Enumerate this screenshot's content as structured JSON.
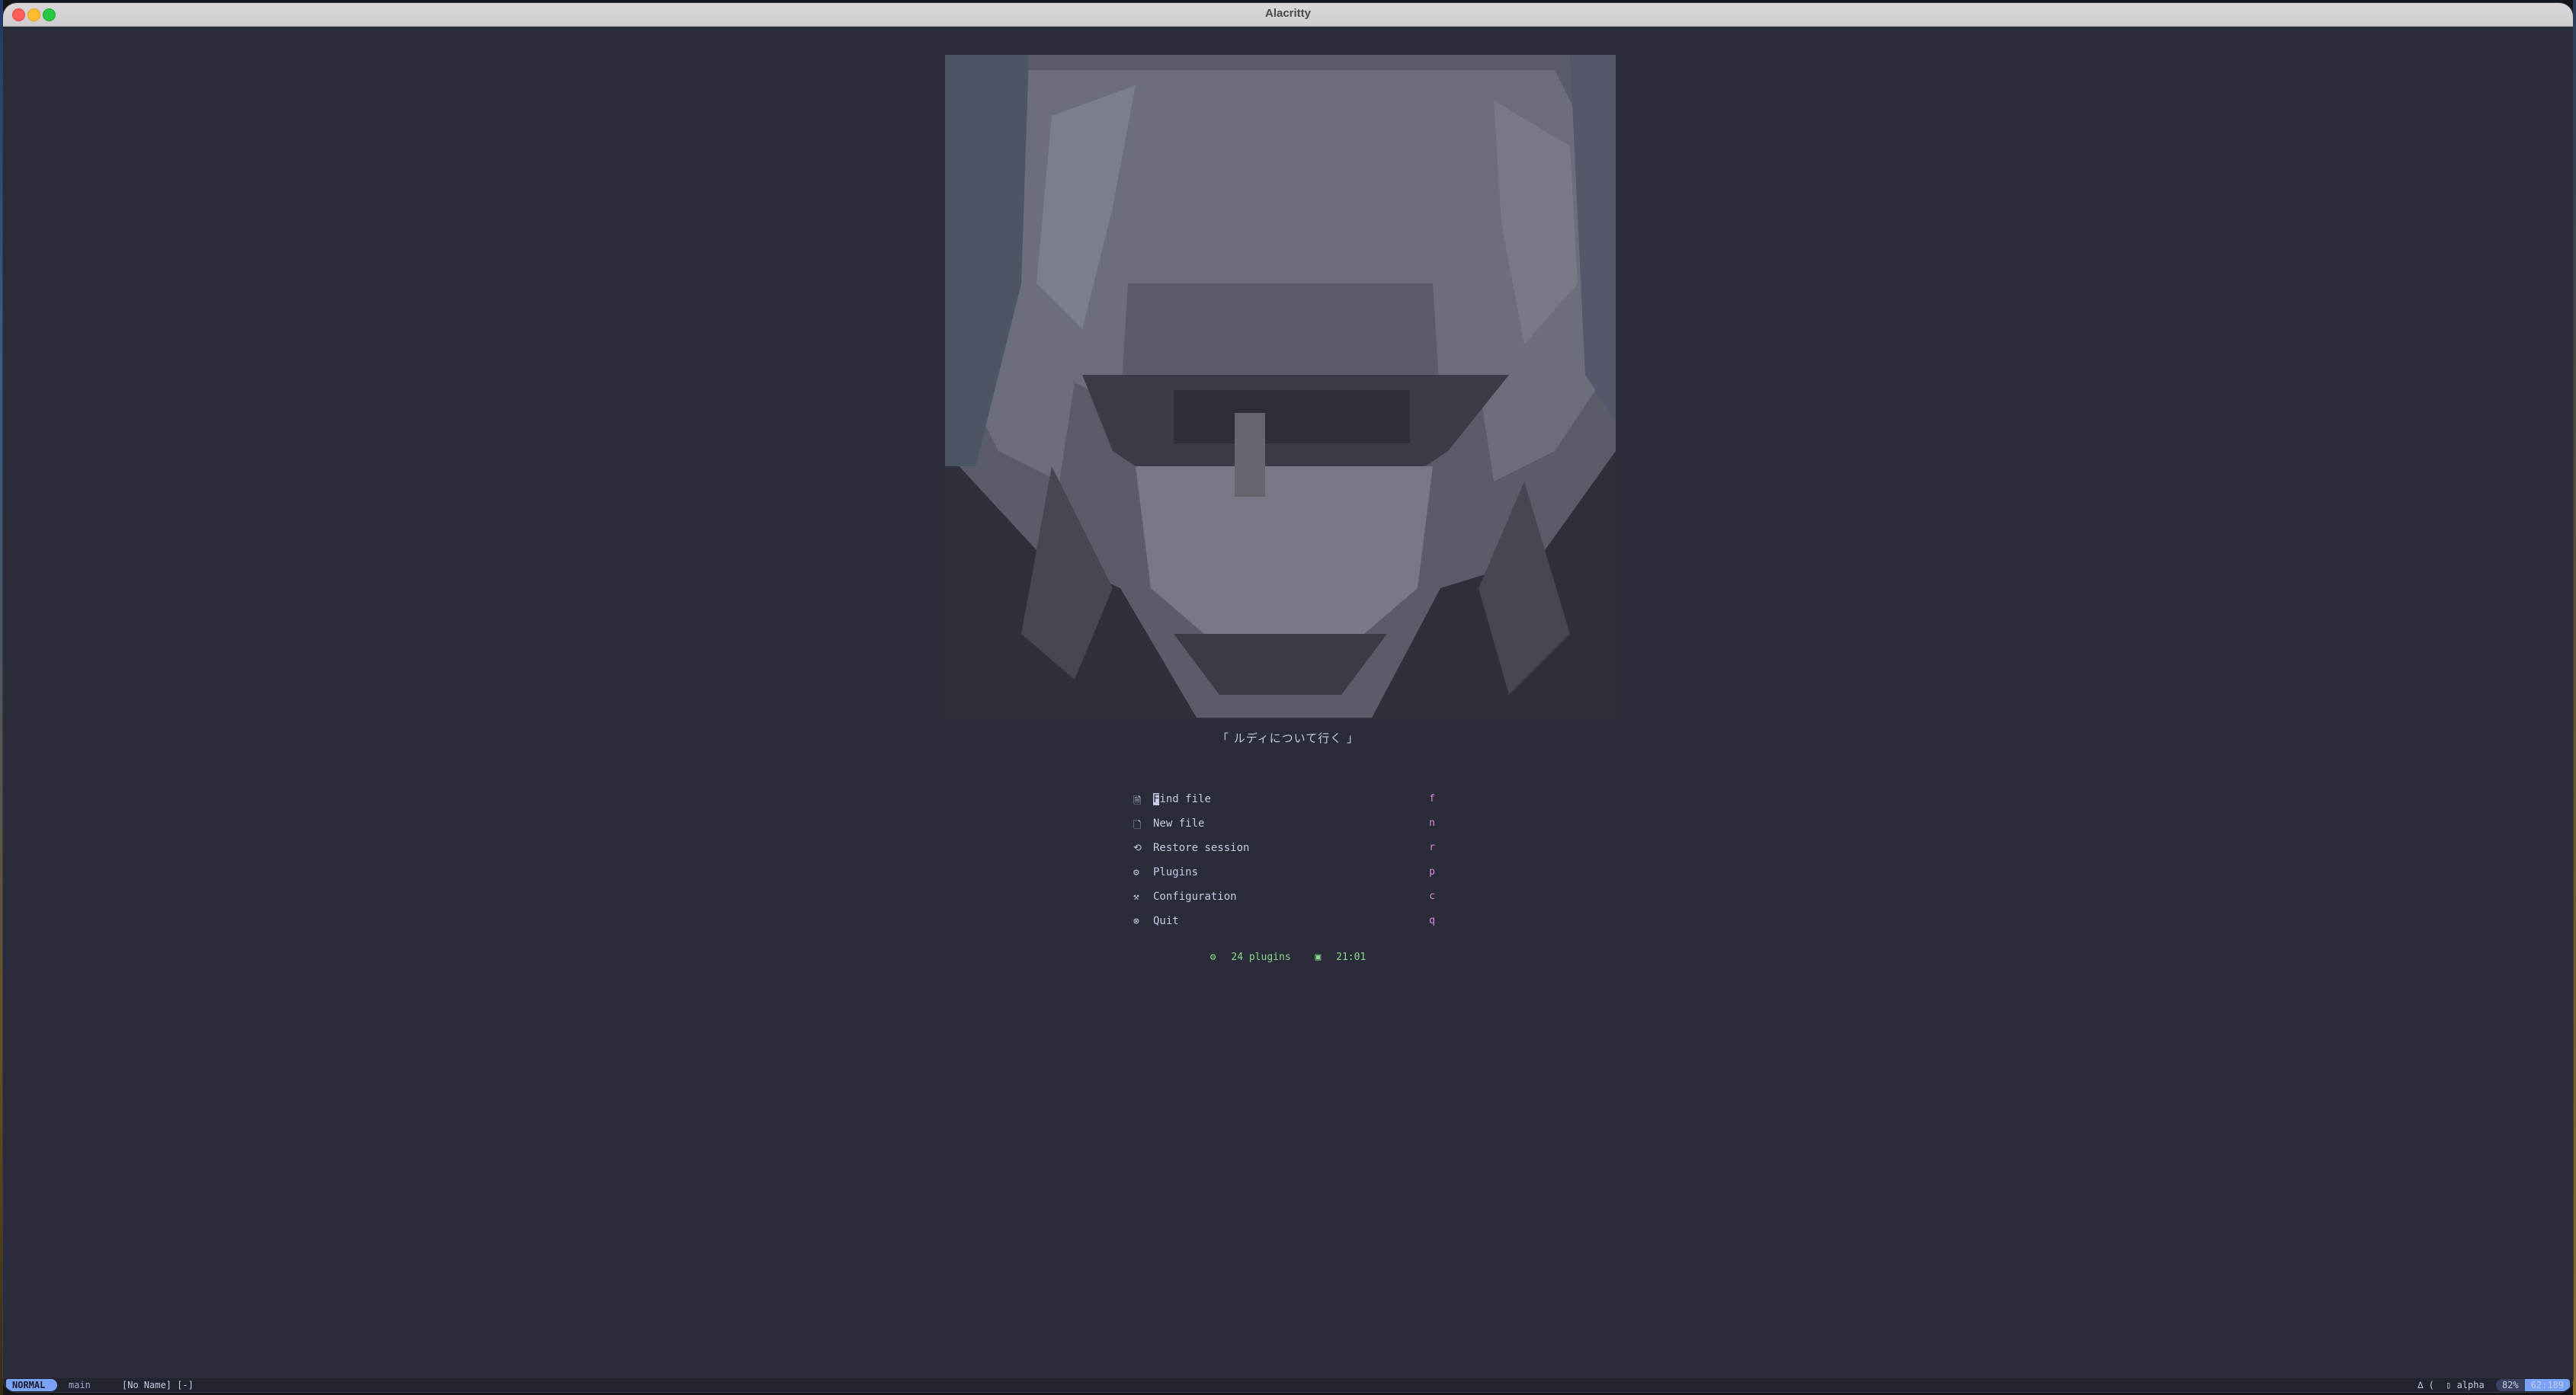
{
  "window": {
    "title": "Alacritty"
  },
  "dashboard": {
    "tagline": "「 ルディについて行く 」",
    "menu": [
      {
        "icon": "file-search-icon",
        "glyph": "🗎",
        "label": "Find file",
        "key": "f"
      },
      {
        "icon": "new-file-icon",
        "glyph": "🗋",
        "label": "New file",
        "key": "n"
      },
      {
        "icon": "restore-icon",
        "glyph": "⟲",
        "label": "Restore session",
        "key": "r"
      },
      {
        "icon": "plugins-icon",
        "glyph": "⚙",
        "label": "Plugins",
        "key": "p"
      },
      {
        "icon": "config-icon",
        "glyph": "⚒",
        "label": "Configuration",
        "key": "c"
      },
      {
        "icon": "quit-icon",
        "glyph": "⊗",
        "label": "Quit",
        "key": "q"
      }
    ],
    "footer": {
      "plugins": "24 plugins",
      "time": "21:01"
    }
  },
  "statusline": {
    "mode": "NORMAL",
    "branch": "main",
    "file": "[No Name] [-]",
    "filetype": "alpha",
    "percent": "82%",
    "position": "62:189"
  },
  "colors": {
    "bg": "#2a2c3a",
    "accent": "#7aa2f7",
    "key": "#d88adf",
    "green": "#8ad68a"
  }
}
